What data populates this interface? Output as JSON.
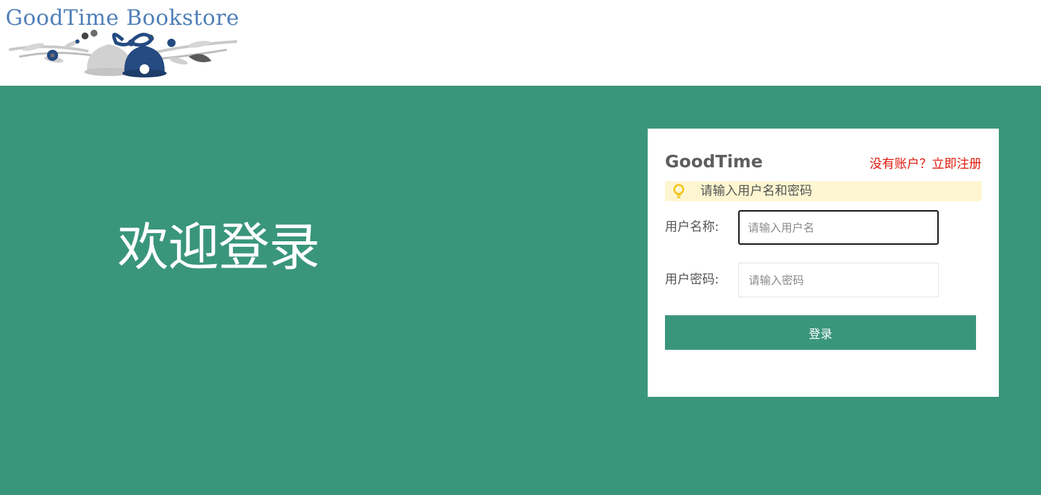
{
  "header": {
    "logo_text": "GoodTime Bookstore",
    "logo_icon": "bells-icon"
  },
  "main": {
    "welcome": "欢迎登录"
  },
  "login": {
    "brand": "GoodTime",
    "register_link": "没有账户？立即注册",
    "tip": "请输入用户名和密码",
    "tip_icon": "lightbulb-icon",
    "username_label": "用户名称:",
    "username_placeholder": "请输入用户名",
    "username_value": "",
    "password_label": "用户密码:",
    "password_placeholder": "请输入密码",
    "password_value": "",
    "submit_label": "登录"
  },
  "colors": {
    "accent": "#3a967b",
    "link": "#e1180c",
    "tip_background": "#fdf6d1",
    "tip_icon": "#f5c518",
    "logo_text": "#4f7fb8"
  }
}
